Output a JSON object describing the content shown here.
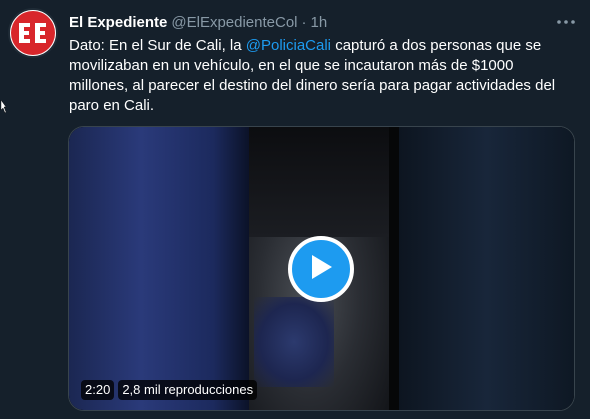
{
  "tweet": {
    "author_name": "El Expediente",
    "author_handle": "@ElExpedienteCol",
    "separator": "·",
    "time": "1h",
    "avatar_initials": "EE",
    "text_before": "Dato: En el Sur de Cali, la ",
    "mention": "@PoliciaCali",
    "text_after": " capturó a dos personas que se movilizaban en un vehículo, en el que se incautaron más de $1000 millones, al parecer el destino del dinero sería para pagar actividades del paro en Cali."
  },
  "video": {
    "duration": "2:20",
    "views": "2,8 mil reproducciones"
  },
  "icons": {
    "more": "more-options-icon",
    "play": "play-icon",
    "cursor": "mouse-cursor-icon"
  },
  "colors": {
    "background": "#15202b",
    "accent": "#1d9bf0",
    "muted": "#8899a6",
    "avatar_red": "#d8262b"
  }
}
